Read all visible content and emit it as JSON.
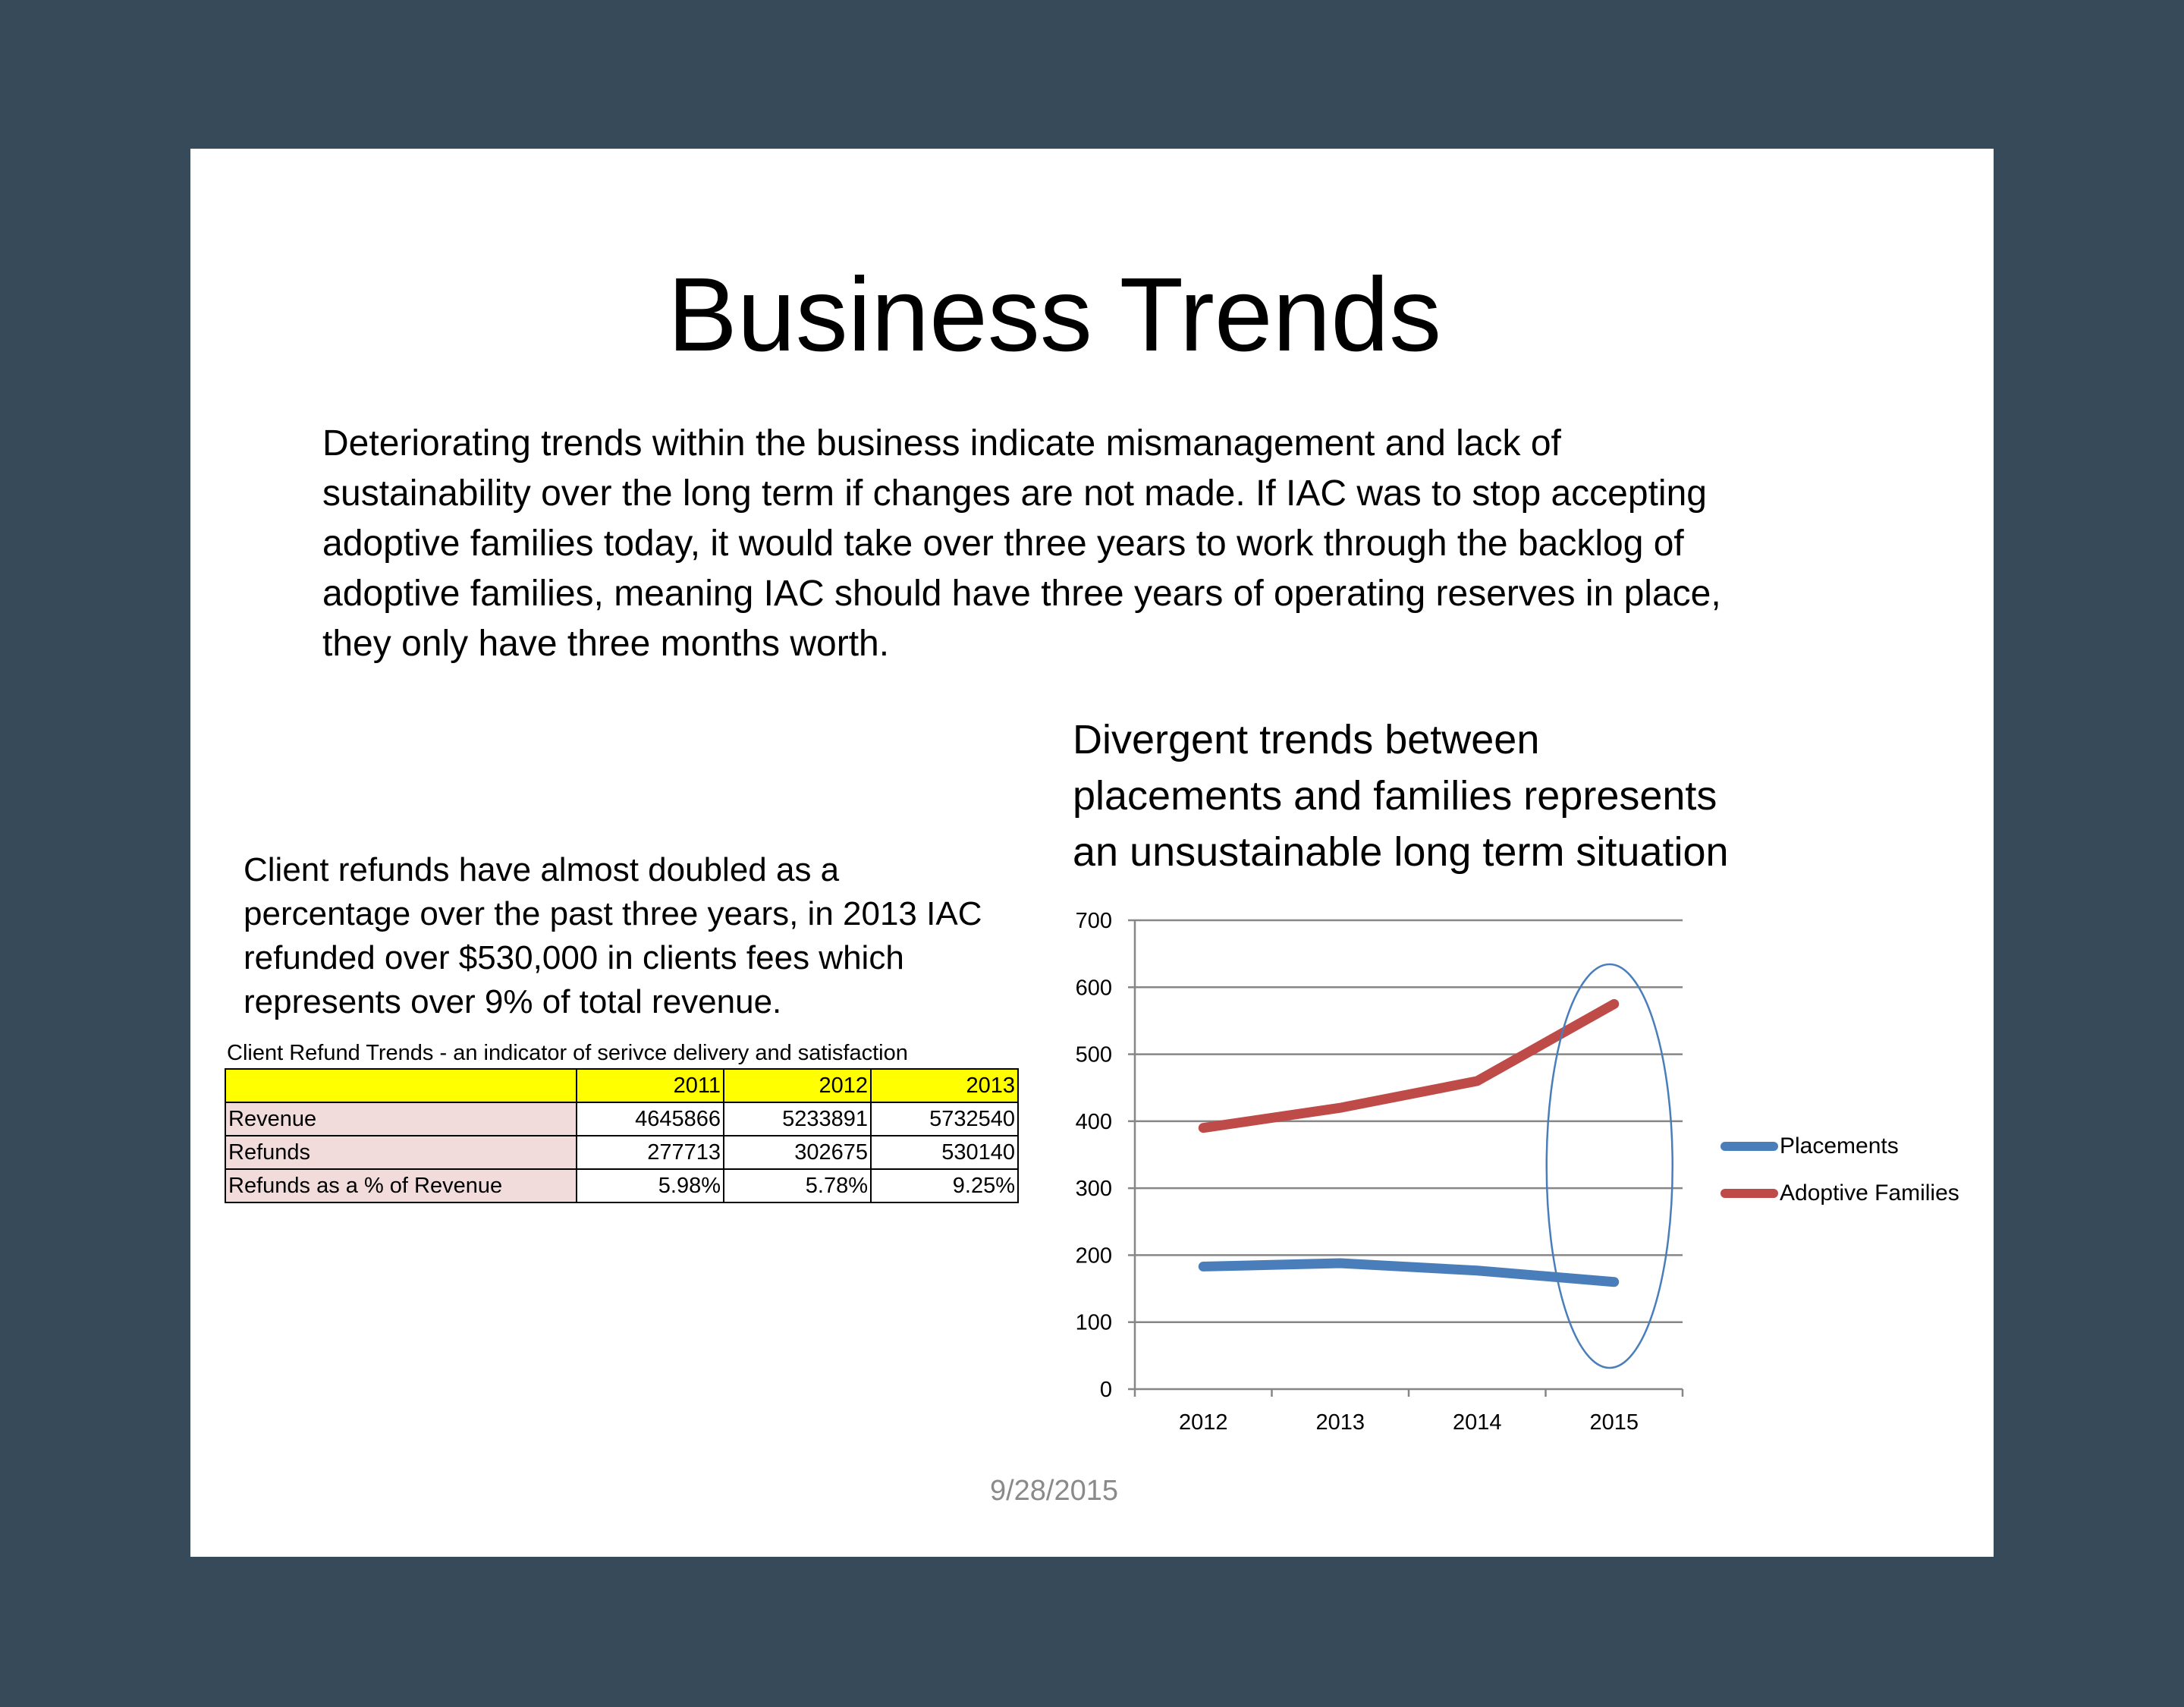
{
  "slide": {
    "title": "Business Trends",
    "body": "Deteriorating trends within the business indicate mismanagement and lack of\nsustainability over the long term if changes are not made.  If IAC was to stop accepting\nadoptive families today, it would take over three years to work through the backlog of\nadoptive families, meaning IAC should have three years of operating reserves in place,\nthey only have three months worth.",
    "refund_text": "Client refunds have almost doubled as a\npercentage over the past three years, in 2013 IAC\nrefunded over $530,000 in clients fees which\nrepresents over 9% of total revenue.",
    "table_caption": "Client Refund Trends - an indicator of serivce delivery and satisfaction",
    "date": "9/28/2015"
  },
  "table": {
    "header": [
      "",
      "2011",
      "2012",
      "2013"
    ],
    "rows": [
      [
        "Revenue",
        "4645866",
        "5233891",
        "5732540"
      ],
      [
        "Refunds",
        "277713",
        "302675",
        "530140"
      ],
      [
        "Refunds as a % of Revenue",
        "5.98%",
        "5.78%",
        "9.25%"
      ]
    ]
  },
  "chart_data": [
    {
      "type": "table",
      "title": "Client Refund Trends - an indicator of serivce delivery and satisfaction",
      "columns": [
        "2011",
        "2012",
        "2013"
      ],
      "rows": [
        {
          "name": "Revenue",
          "values": [
            4645866,
            5233891,
            5732540
          ]
        },
        {
          "name": "Refunds",
          "values": [
            277713,
            302675,
            530140
          ]
        },
        {
          "name": "Refunds as a % of Revenue",
          "values": [
            "5.98%",
            "5.78%",
            "9.25%"
          ]
        }
      ]
    },
    {
      "type": "line",
      "title": "Divergent trends between\nplacements and families represents\nan unsustainable long term situation",
      "categories": [
        "2012",
        "2013",
        "2014",
        "2015"
      ],
      "series": [
        {
          "name": "Placements",
          "values": [
            183,
            188,
            177,
            160
          ],
          "color": "#4a7ebb"
        },
        {
          "name": "Adoptive Families",
          "values": [
            390,
            420,
            460,
            575
          ],
          "color": "#be4b48"
        }
      ],
      "ylim": [
        0,
        700
      ],
      "yticks": [
        "0",
        "100",
        "200",
        "300",
        "400",
        "500",
        "600",
        "700"
      ],
      "grid": true,
      "legend": "right",
      "annotation": "ellipse around 2015",
      "annotation_color": "#4a7ebb"
    }
  ]
}
